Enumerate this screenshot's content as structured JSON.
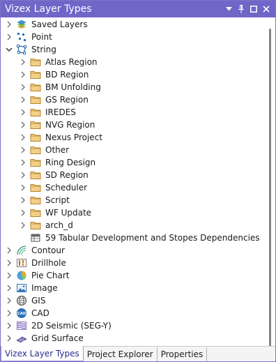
{
  "panel": {
    "title": "Vizex Layer Types",
    "buttons": [
      "dropdown-icon",
      "pin-icon",
      "maximize-icon",
      "close-icon"
    ]
  },
  "tree": [
    {
      "label": "Saved Layers",
      "level": 0,
      "expander": "collapsed",
      "icon": "layers-icon"
    },
    {
      "label": "Point",
      "level": 0,
      "expander": "collapsed",
      "icon": "point-icon"
    },
    {
      "label": "String",
      "level": 0,
      "expander": "expanded",
      "icon": "string-icon"
    },
    {
      "label": "Atlas Region",
      "level": 1,
      "expander": "collapsed",
      "icon": "folder-icon"
    },
    {
      "label": "BD Region",
      "level": 1,
      "expander": "collapsed",
      "icon": "folder-icon"
    },
    {
      "label": "BM Unfolding",
      "level": 1,
      "expander": "collapsed",
      "icon": "folder-icon"
    },
    {
      "label": "GS Region",
      "level": 1,
      "expander": "collapsed",
      "icon": "folder-icon"
    },
    {
      "label": "IREDES",
      "level": 1,
      "expander": "collapsed",
      "icon": "folder-icon"
    },
    {
      "label": "NVG Region",
      "level": 1,
      "expander": "collapsed",
      "icon": "folder-icon"
    },
    {
      "label": "Nexus Project",
      "level": 1,
      "expander": "collapsed",
      "icon": "folder-icon"
    },
    {
      "label": "Other",
      "level": 1,
      "expander": "collapsed",
      "icon": "folder-icon"
    },
    {
      "label": "Ring Design",
      "level": 1,
      "expander": "collapsed",
      "icon": "folder-icon"
    },
    {
      "label": "SD Region",
      "level": 1,
      "expander": "collapsed",
      "icon": "folder-icon"
    },
    {
      "label": "Scheduler",
      "level": 1,
      "expander": "collapsed",
      "icon": "folder-icon"
    },
    {
      "label": "Script",
      "level": 1,
      "expander": "collapsed",
      "icon": "folder-icon"
    },
    {
      "label": "WF Update",
      "level": 1,
      "expander": "collapsed",
      "icon": "folder-icon"
    },
    {
      "label": "arch_d",
      "level": 1,
      "expander": "collapsed",
      "icon": "folder-icon"
    },
    {
      "label": "59 Tabular Development and Stopes Dependencies",
      "level": 1,
      "expander": "none",
      "icon": "table-icon"
    },
    {
      "label": "Contour",
      "level": 0,
      "expander": "collapsed",
      "icon": "contour-icon"
    },
    {
      "label": "Drillhole",
      "level": 0,
      "expander": "collapsed",
      "icon": "drillhole-icon"
    },
    {
      "label": "Pie Chart",
      "level": 0,
      "expander": "collapsed",
      "icon": "pie-chart-icon"
    },
    {
      "label": "Image",
      "level": 0,
      "expander": "collapsed",
      "icon": "image-icon"
    },
    {
      "label": "GIS",
      "level": 0,
      "expander": "collapsed",
      "icon": "globe-icon"
    },
    {
      "label": "CAD",
      "level": 0,
      "expander": "collapsed",
      "icon": "cad-icon"
    },
    {
      "label": "2D Seismic (SEG-Y)",
      "level": 0,
      "expander": "collapsed",
      "icon": "seismic-icon"
    },
    {
      "label": "Grid Surface",
      "level": 0,
      "expander": "collapsed",
      "icon": "grid-surface-icon"
    }
  ],
  "tabs": [
    {
      "label": "Vizex Layer Types",
      "active": true
    },
    {
      "label": "Project Explorer",
      "active": false
    },
    {
      "label": "Properties",
      "active": false
    }
  ],
  "colors": {
    "title_bar": "#6f66c8",
    "folder": "#e8c06a",
    "active_tab_text": "#2a2a8a"
  }
}
